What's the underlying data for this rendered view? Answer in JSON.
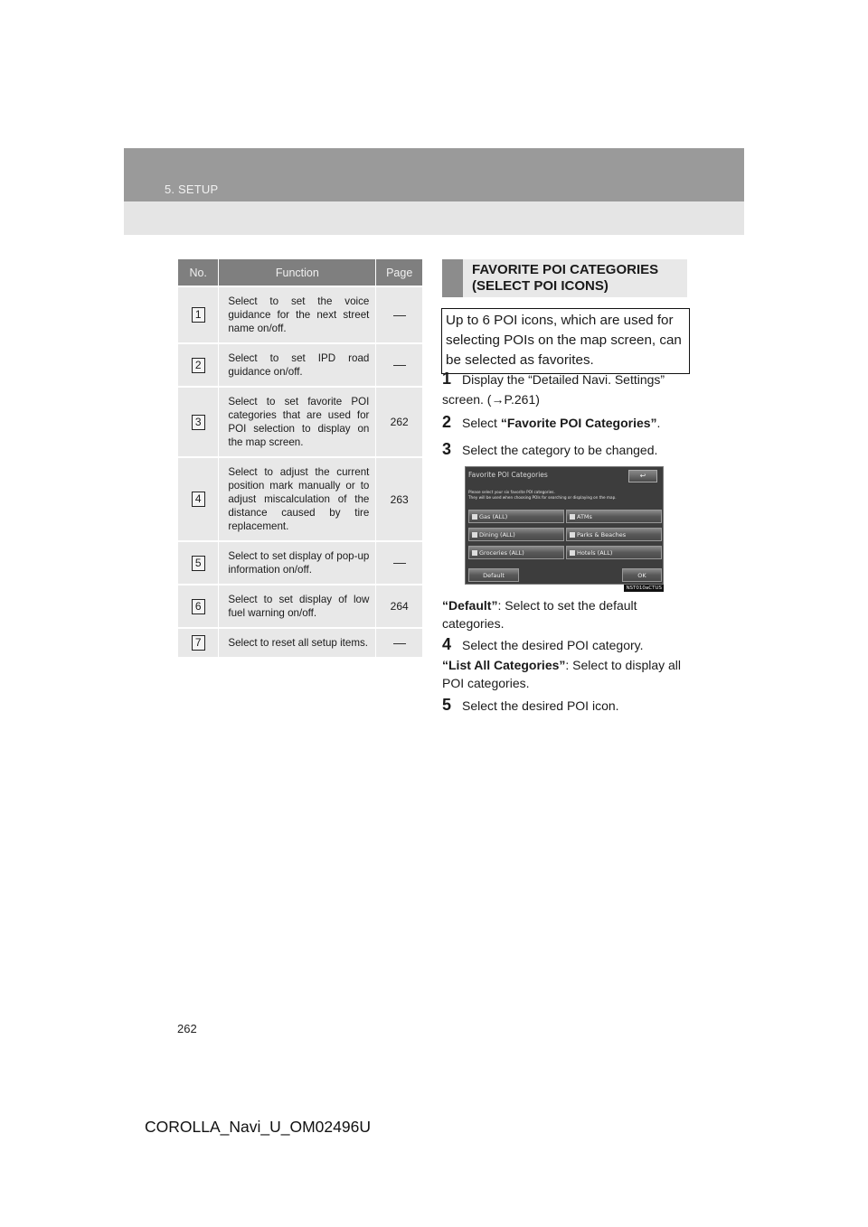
{
  "header": {
    "section": "5. SETUP"
  },
  "table": {
    "columns": [
      "No.",
      "Function",
      "Page"
    ],
    "rows": [
      {
        "no": "1",
        "function": "Select to set the voice guidance for the next street name on/off.",
        "page": "—"
      },
      {
        "no": "2",
        "function": "Select to set IPD road guidance on/off.",
        "page": "—"
      },
      {
        "no": "3",
        "function": "Select to set favorite POI categories that are used for POI selection to display on the map screen.",
        "page": "262"
      },
      {
        "no": "4",
        "function": "Select to adjust the current position mark manually or to adjust miscalculation of the distance caused by tire replacement.",
        "page": "263"
      },
      {
        "no": "5",
        "function": "Select to set display of pop-up information on/off.",
        "page": "—"
      },
      {
        "no": "6",
        "function": "Select to set display of low fuel warning on/off.",
        "page": "264"
      },
      {
        "no": "7",
        "function": "Select to reset all setup items.",
        "page": "—"
      }
    ]
  },
  "section": {
    "heading_line1": "FAVORITE POI CATEGORIES",
    "heading_line2": "(SELECT POI ICONS)",
    "intro": "Up to 6 POI icons, which are used for selecting POIs on the map screen, can be selected as favorites."
  },
  "steps": [
    {
      "n": "1",
      "pre": "Display the “Detailed Navi. Settings” screen. (→P.261)",
      "bold": "",
      "post": ""
    },
    {
      "n": "2",
      "pre": "Select ",
      "bold": "“Favorite POI Categories”",
      "post": "."
    },
    {
      "n": "3",
      "pre": "Select the category to be changed.",
      "bold": "",
      "post": ""
    },
    {
      "n": "4",
      "pre": "Select the desired POI category.",
      "bold": "",
      "post": ""
    },
    {
      "n": "5",
      "pre": "Select the desired POI icon.",
      "bold": "",
      "post": ""
    }
  ],
  "notes": {
    "default": {
      "bold": "“Default”",
      "text": ": Select to set the default categories."
    },
    "list_all": {
      "bold": "“List All Categories”",
      "text": ": Select to display all POI categories."
    }
  },
  "screenshot": {
    "title": "Favorite POI Categories",
    "back_icon": "↩",
    "message_line1": "Please select your six favorite POI categories.",
    "message_line2": "They will be used when choosing POIs for searching or displaying on the map.",
    "categories": [
      "Gas (ALL)",
      "ATMs",
      "Dining (ALL)",
      "Parks & Beaches",
      "Groceries (ALL)",
      "Hotels (ALL)"
    ],
    "default_button": "Default",
    "ok_button": "OK",
    "image_code": "NST010aCTUS"
  },
  "page_number": "262",
  "footer": "COROLLA_Navi_U_OM02496U"
}
